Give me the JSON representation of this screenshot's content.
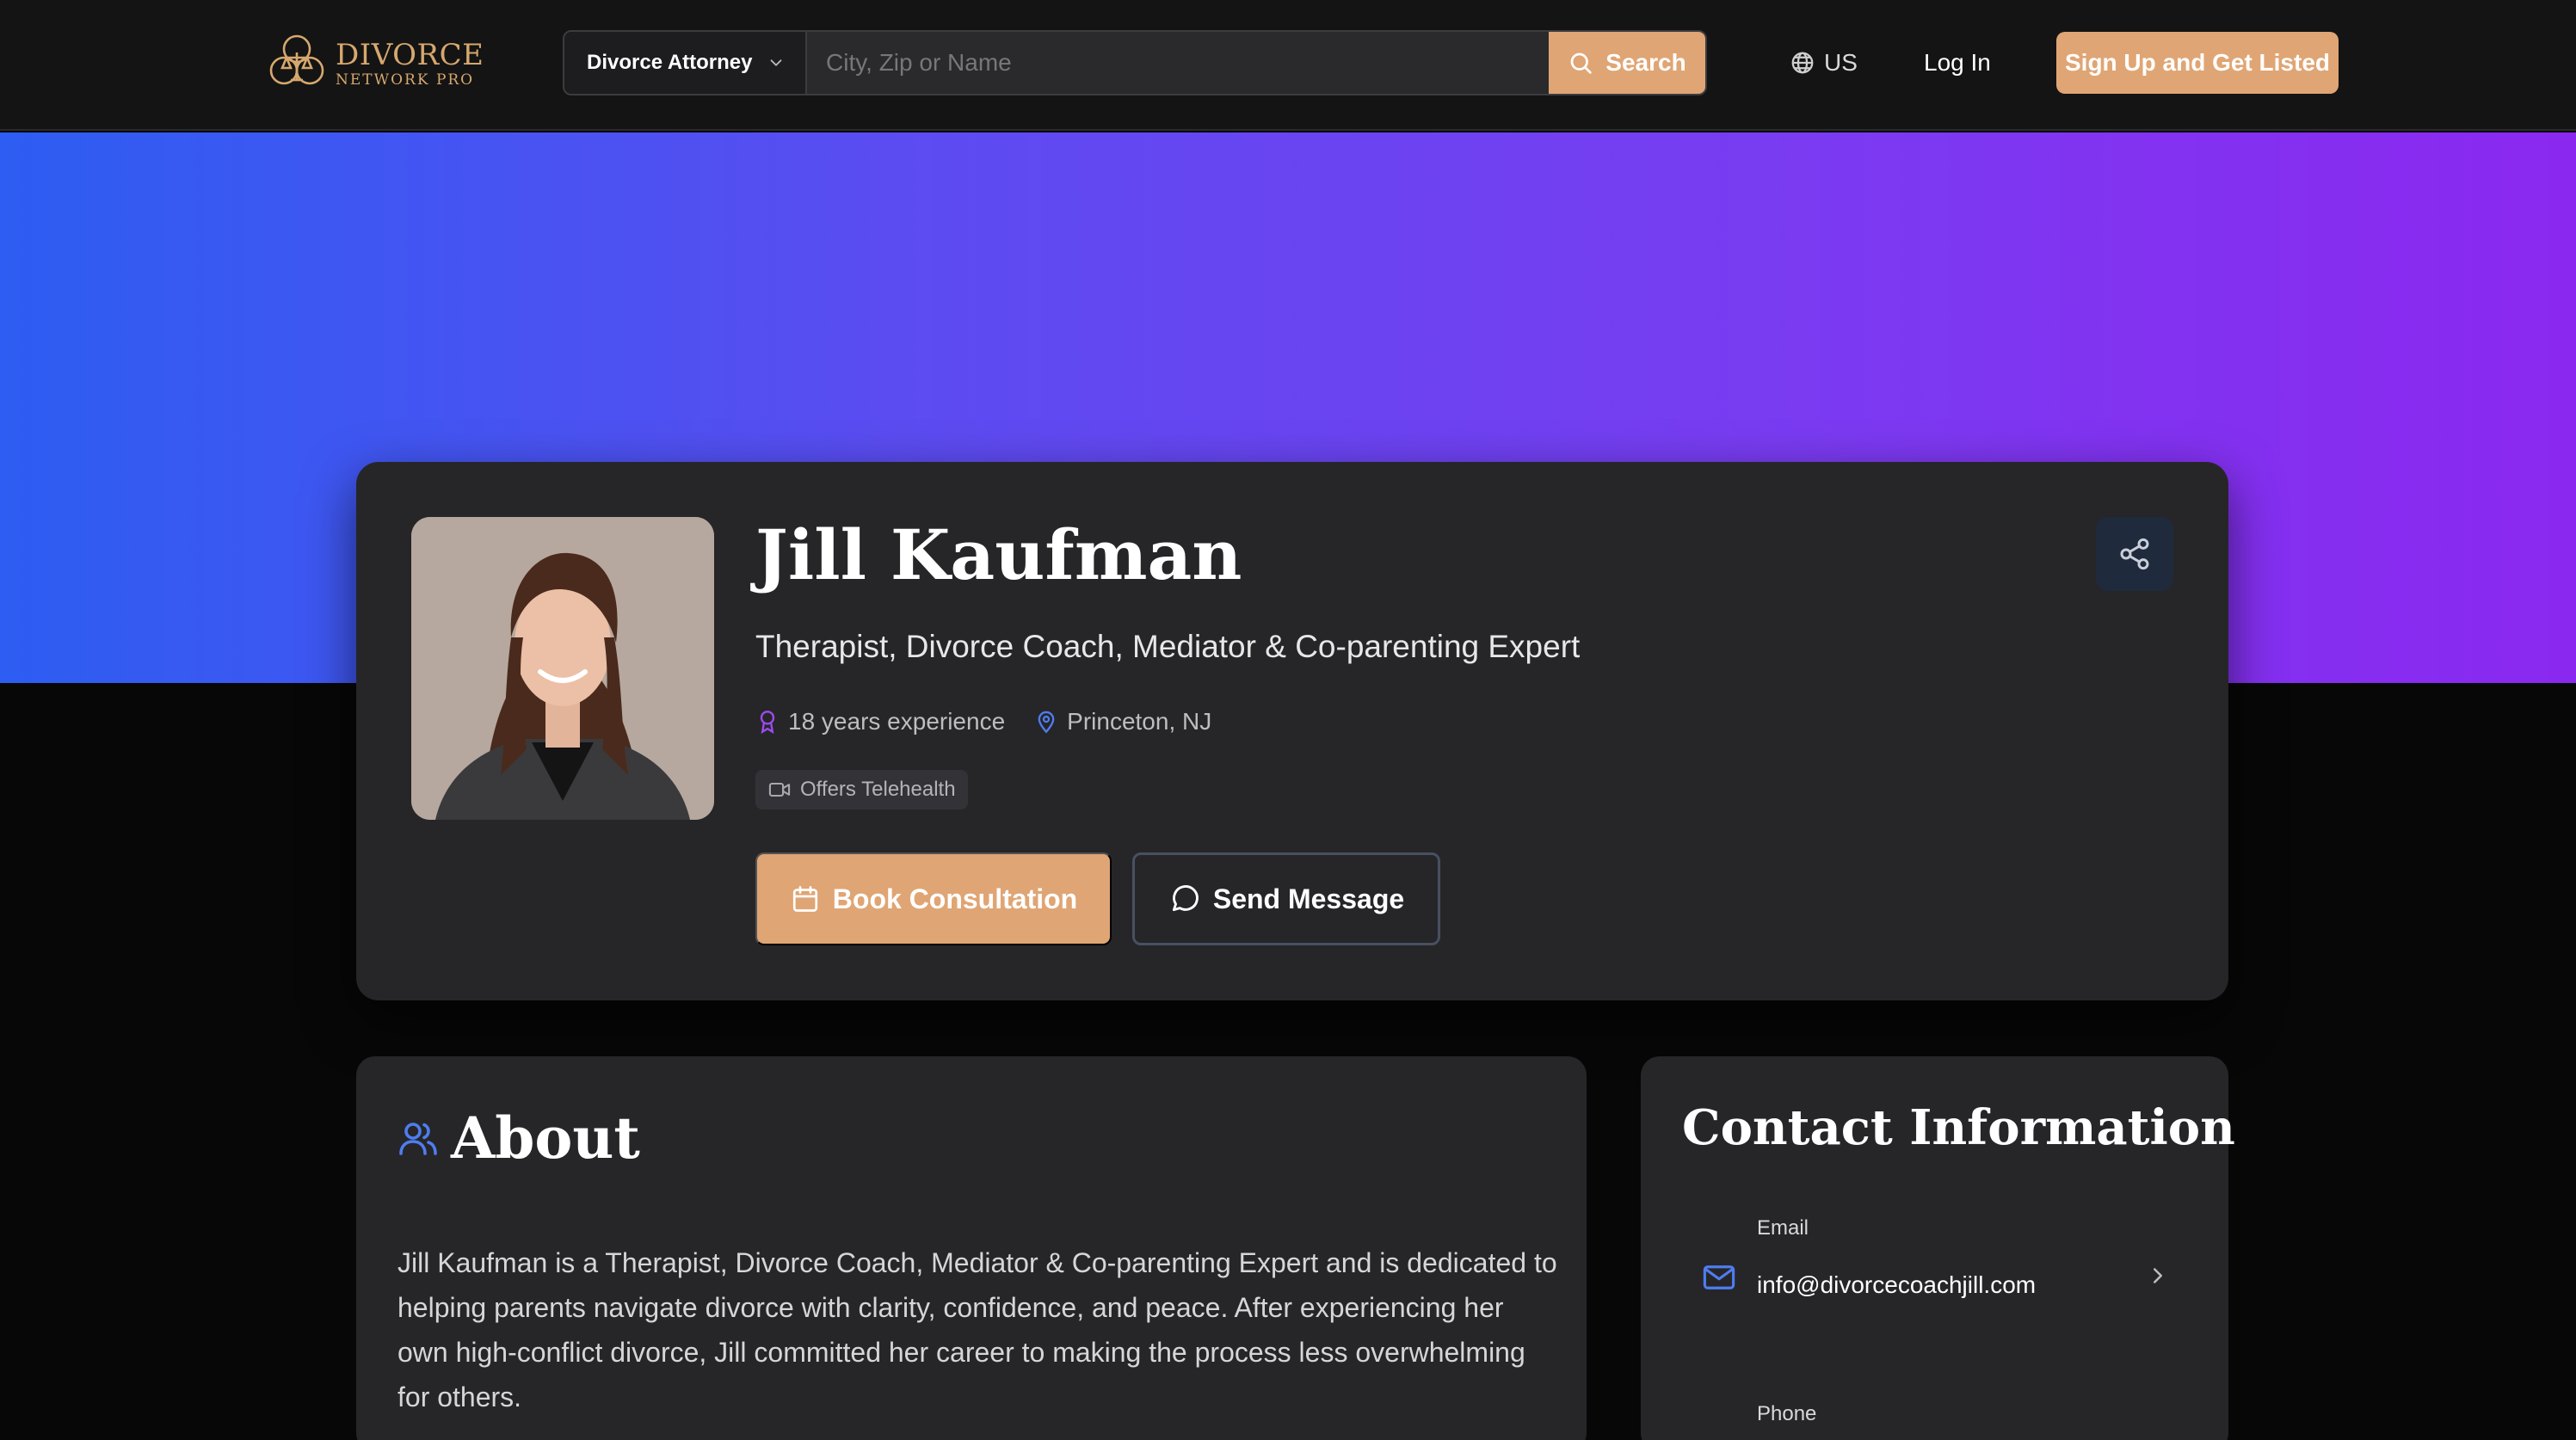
{
  "nav": {
    "logo_line1": "DIVORCE",
    "logo_line2": "NETWORK PRO",
    "category": "Divorce Attorney",
    "search_placeholder": "City, Zip or Name",
    "search_label": "Search",
    "locale": "US",
    "login": "Log In",
    "signup": "Sign Up and Get Listed"
  },
  "profile": {
    "name": "Jill Kaufman",
    "title": "Therapist, Divorce Coach, Mediator & Co-parenting Expert",
    "experience": "18 years experience",
    "location": "Princeton, NJ",
    "telehealth": "Offers Telehealth",
    "book_label": "Book Consultation",
    "message_label": "Send Message"
  },
  "about": {
    "title": "About",
    "body": "Jill Kaufman is a Therapist, Divorce Coach, Mediator & Co-parenting Expert and is dedicated to helping parents navigate divorce with clarity, confidence, and peace. After experiencing her own high-conflict divorce, Jill committed her career to making the process less overwhelming for others."
  },
  "contact": {
    "title": "Contact Information",
    "email_label": "Email",
    "email": "info@divorcecoachjill.com",
    "phone_label": "Phone"
  },
  "colors": {
    "accent": "#e0a574",
    "hero_start": "#2d5df2",
    "hero_end": "#8b28f0",
    "card_bg": "#262629",
    "page_bg": "#070707"
  },
  "icons": {
    "logo": "scales-of-justice-icon",
    "category_chevron": "chevron-down-icon",
    "search": "search-icon",
    "locale": "globe-icon",
    "share": "share-icon",
    "experience": "award-icon",
    "location": "map-pin-icon",
    "telehealth": "video-icon",
    "book": "calendar-icon",
    "message": "message-bubble-icon",
    "about": "users-icon",
    "email": "mail-icon",
    "email_chevron": "chevron-right-icon"
  }
}
